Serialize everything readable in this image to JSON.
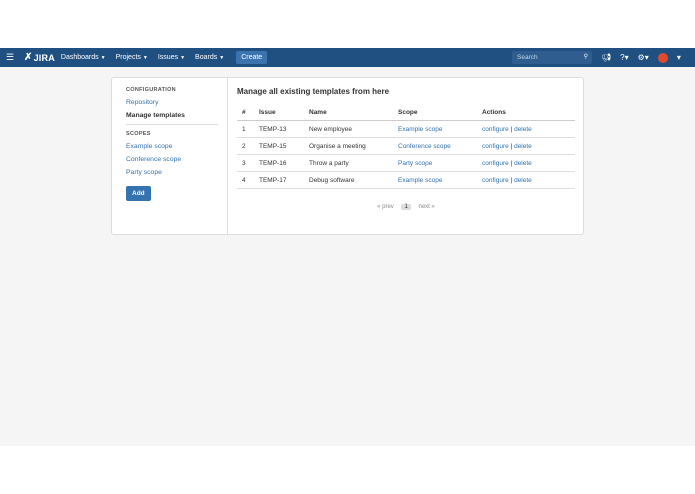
{
  "header": {
    "menu_icon": "menu-icon",
    "logo_text": "JIRA",
    "nav": [
      "Dashboards",
      "Projects",
      "Issues",
      "Boards"
    ],
    "create_label": "Create",
    "search_placeholder": "Search",
    "colors": {
      "bar": "#205081",
      "create": "#3b73af"
    }
  },
  "sidebar": {
    "config_heading": "CONFIGURATION",
    "config_items": [
      "Repository",
      "Manage templates"
    ],
    "active_item": "Manage templates",
    "scopes_heading": "SCOPES",
    "scope_items": [
      "Example scope",
      "Conference scope",
      "Party scope"
    ],
    "add_label": "Add"
  },
  "main": {
    "title": "Manage all existing templates from here",
    "columns": [
      "#",
      "Issue",
      "Name",
      "Scope",
      "Actions"
    ],
    "rows": [
      {
        "num": "1",
        "issue": "TEMP-13",
        "name": "New employee",
        "scope": "Example scope",
        "configure": "configure",
        "sep": "|",
        "delete": "delete"
      },
      {
        "num": "2",
        "issue": "TEMP-15",
        "name": "Organise a meeting",
        "scope": "Conference scope",
        "configure": "configure",
        "sep": "|",
        "delete": "delete"
      },
      {
        "num": "3",
        "issue": "TEMP-16",
        "name": "Throw a party",
        "scope": "Party scope",
        "configure": "configure",
        "sep": "|",
        "delete": "delete"
      },
      {
        "num": "4",
        "issue": "TEMP-17",
        "name": "Debug software",
        "scope": "Example scope",
        "configure": "configure",
        "sep": "|",
        "delete": "delete"
      }
    ],
    "pager": {
      "prev": "« prev",
      "current": "1",
      "next": "next »"
    }
  }
}
